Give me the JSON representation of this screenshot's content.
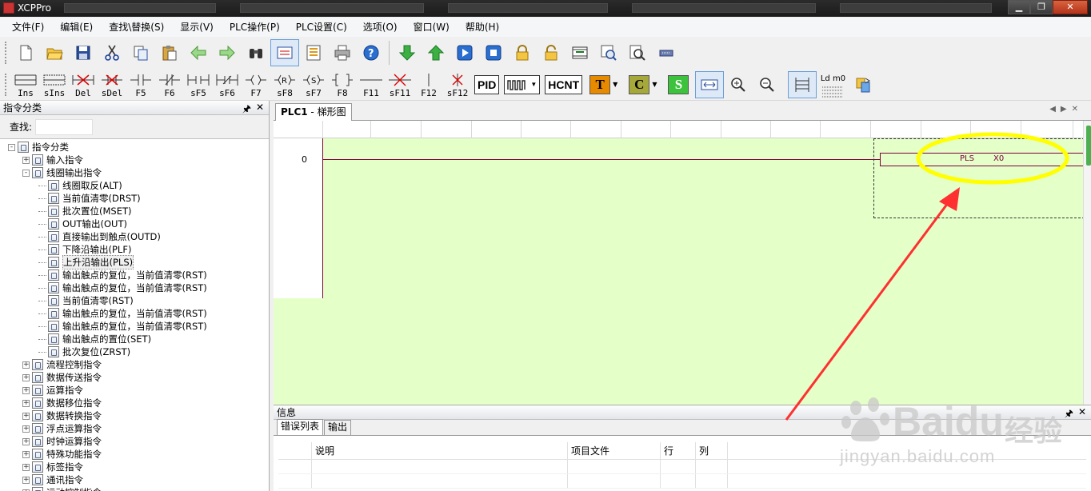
{
  "window": {
    "title": "XCPPro"
  },
  "menu": [
    "文件(F)",
    "编辑(E)",
    "查找\\替换(S)",
    "显示(V)",
    "PLC操作(P)",
    "PLC设置(C)",
    "选项(O)",
    "窗口(W)",
    "帮助(H)"
  ],
  "toolbar2": {
    "ins": "Ins",
    "sins": "sIns",
    "del": "Del",
    "sdel": "sDel",
    "f5": "F5",
    "f6": "F6",
    "sf5": "sF5",
    "sf6": "sF6",
    "f7": "F7",
    "sf8": "sF8",
    "sf7": "sF7",
    "f8": "F8",
    "f11": "F11",
    "sf11": "sF11",
    "f12": "F12",
    "sf12": "sF12",
    "pid": "PID",
    "hcnt": "HCNT",
    "t": "T",
    "c": "C",
    "s": "S",
    "ldm0": "Ld m0",
    "coil_r": "R",
    "coil_s": "S"
  },
  "left_panel": {
    "title": "指令分类",
    "search_label": "查找:",
    "tree": [
      {
        "label": "指令分类",
        "level": 0,
        "expander": "-"
      },
      {
        "label": "输入指令",
        "level": 1,
        "expander": "+"
      },
      {
        "label": "线圈输出指令",
        "level": 1,
        "expander": "-"
      },
      {
        "label": "线圈取反(ALT)",
        "level": 2
      },
      {
        "label": "当前值清零(DRST)",
        "level": 2
      },
      {
        "label": "批次置位(MSET)",
        "level": 2
      },
      {
        "label": "OUT输出(OUT)",
        "level": 2
      },
      {
        "label": "直接输出到触点(OUTD)",
        "level": 2
      },
      {
        "label": "下降沿输出(PLF)",
        "level": 2
      },
      {
        "label": "上升沿输出(PLS)",
        "level": 2,
        "selected": true
      },
      {
        "label": "输出触点的复位，当前值清零(RST)",
        "level": 2
      },
      {
        "label": "输出触点的复位，当前值清零(RST)",
        "level": 2
      },
      {
        "label": "当前值清零(RST)",
        "level": 2
      },
      {
        "label": "输出触点的复位，当前值清零(RST)",
        "level": 2
      },
      {
        "label": "输出触点的复位，当前值清零(RST)",
        "level": 2
      },
      {
        "label": "输出触点的置位(SET)",
        "level": 2
      },
      {
        "label": "批次复位(ZRST)",
        "level": 2
      },
      {
        "label": "流程控制指令",
        "level": 1,
        "expander": "+"
      },
      {
        "label": "数据传送指令",
        "level": 1,
        "expander": "+"
      },
      {
        "label": "运算指令",
        "level": 1,
        "expander": "+"
      },
      {
        "label": "数据移位指令",
        "level": 1,
        "expander": "+"
      },
      {
        "label": "数据转换指令",
        "level": 1,
        "expander": "+"
      },
      {
        "label": "浮点运算指令",
        "level": 1,
        "expander": "+"
      },
      {
        "label": "时钟运算指令",
        "level": 1,
        "expander": "+"
      },
      {
        "label": "特殊功能指令",
        "level": 1,
        "expander": "+"
      },
      {
        "label": "标签指令",
        "level": 1,
        "expander": "+"
      },
      {
        "label": "通讯指令",
        "level": 1,
        "expander": "+"
      },
      {
        "label": "运动控制指令",
        "level": 1,
        "expander": "+"
      }
    ]
  },
  "editor": {
    "tab_plc": "PLC1",
    "tab_sep": " - ",
    "tab_view": "梯形图",
    "row_number": "0",
    "instruction": "PLS",
    "operand": "X0"
  },
  "info_panel": {
    "title": "信息",
    "tabs": [
      "错误列表",
      "输出"
    ],
    "columns": [
      "",
      "说明",
      "项目文件",
      "行",
      "列",
      ""
    ]
  },
  "colors": {
    "ladder_bg": "#e4ffc8",
    "rung": "#800040",
    "highlight_ellipse": "#ffff00",
    "arrow": "#ff3030"
  },
  "watermark": {
    "brand": "Baidu",
    "cn": "经验",
    "url": "jingyan.baidu.com"
  }
}
